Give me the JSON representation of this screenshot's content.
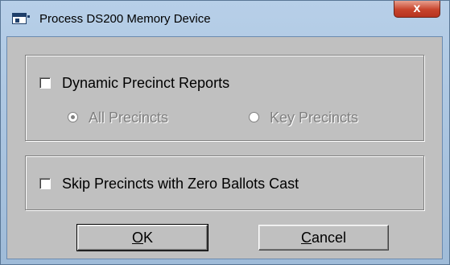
{
  "window": {
    "title": "Process DS200 Memory Device",
    "close_glyph": "x",
    "icon": "app-icon"
  },
  "options": {
    "dynamic_reports": {
      "label": "Dynamic Precinct Reports",
      "checked": false
    },
    "radios": [
      {
        "label": "All Precincts",
        "selected": true,
        "enabled": false
      },
      {
        "label": "Key Precincts",
        "selected": false,
        "enabled": false
      }
    ],
    "skip_zero": {
      "label": "Skip Precincts with Zero Ballots Cast",
      "checked": false
    }
  },
  "buttons": {
    "ok": {
      "mnemonic": "O",
      "rest": "K"
    },
    "cancel": {
      "mnemonic": "C",
      "rest": "ancel"
    }
  }
}
